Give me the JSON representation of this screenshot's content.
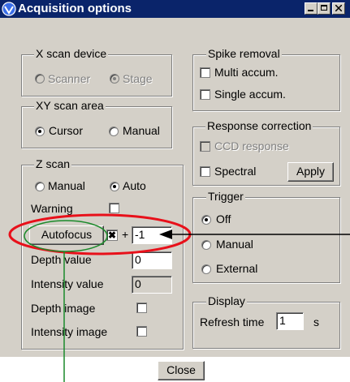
{
  "window": {
    "title": "Acquisition options"
  },
  "x_scan_device": {
    "title": "X scan device",
    "options": [
      "Scanner",
      "Stage"
    ],
    "selected": "Stage"
  },
  "xy_scan_area": {
    "title": "XY scan area",
    "options": [
      "Cursor",
      "Manual"
    ],
    "selected": "Cursor"
  },
  "z_scan": {
    "title": "Z scan",
    "options": [
      "Manual",
      "Auto"
    ],
    "selected": "Auto",
    "warning_label": "Warning",
    "autofocus_label": "Autofocus",
    "autofocus_checkbox_mark": "✖",
    "plus_sign": "+",
    "autofocus_value": "-1",
    "depth_value_label": "Depth value",
    "depth_value": "0",
    "intensity_value_label": "Intensity value",
    "intensity_value": "0",
    "depth_image_label": "Depth image",
    "intensity_image_label": "Intensity image"
  },
  "spike_removal": {
    "title": "Spike removal",
    "multi_label": "Multi accum.",
    "single_label": "Single accum."
  },
  "response_correction": {
    "title": "Response correction",
    "ccd_label": "CCD response",
    "spectral_label": "Spectral",
    "apply_label": "Apply"
  },
  "trigger": {
    "title": "Trigger",
    "options": [
      "Off",
      "Manual",
      "External"
    ],
    "selected": "Off"
  },
  "display": {
    "title": "Display",
    "refresh_label": "Refresh time",
    "refresh_value": "1",
    "unit": "s"
  },
  "close_label": "Close",
  "colors": {
    "highlight_ellipse": "#e8101a",
    "autofocus_ellipse": "#1a8a2a",
    "arrow": "#000000",
    "title_bar": "#0a246a",
    "dialog_face": "#d4d0c8"
  }
}
